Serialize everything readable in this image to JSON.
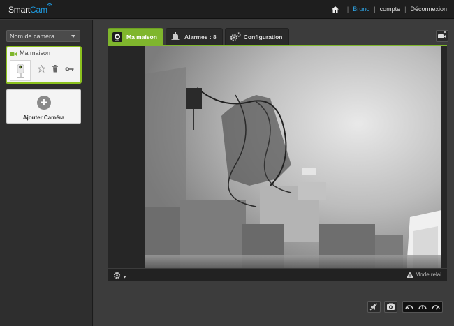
{
  "brand": {
    "name_part1": "Smart",
    "name_part2": "Cam"
  },
  "topnav": {
    "user": "Bruno",
    "account": "compte",
    "logout": "Déconnexion"
  },
  "sidebar": {
    "camera_select": "Nom de caméra",
    "camera_card": {
      "name": "Ma maison"
    },
    "add_camera": "Ajouter Caméra"
  },
  "tabs": [
    {
      "label": "Ma maison",
      "active": true
    },
    {
      "label": "Alarmes : 8",
      "active": false
    },
    {
      "label": "Configuration",
      "active": false
    }
  ],
  "video_toolbar": {
    "relay_label": "Mode relai"
  },
  "colors": {
    "accent_green": "#7fb62d",
    "accent_blue": "#2fa8ea"
  },
  "icons": [
    "home-icon",
    "camera-icon",
    "star-icon",
    "trash-icon",
    "key-icon",
    "plus-icon",
    "webcam-icon",
    "alarm-bell-icon",
    "gears-icon",
    "snapshot-icon",
    "gear-icon",
    "warning-icon",
    "mute-icon",
    "photo-icon",
    "speed-slow-icon",
    "speed-medium-icon",
    "speed-fast-icon"
  ]
}
